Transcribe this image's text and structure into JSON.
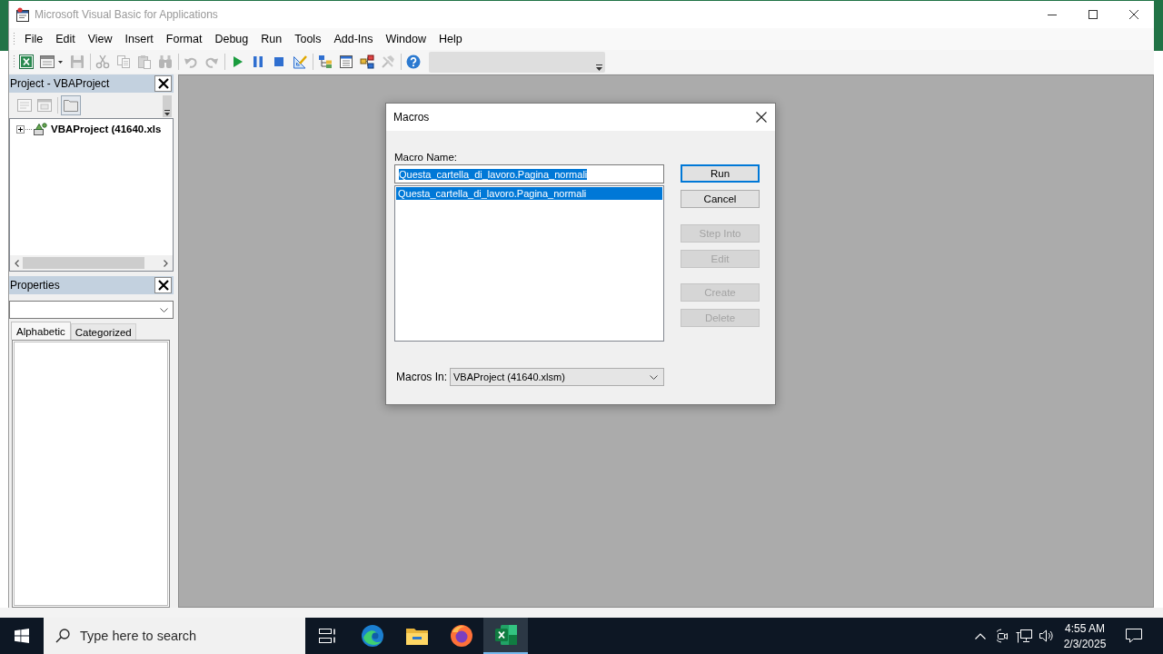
{
  "window": {
    "title": "Microsoft Visual Basic for Applications",
    "active": false
  },
  "menu": [
    "File",
    "Edit",
    "View",
    "Insert",
    "Format",
    "Debug",
    "Run",
    "Tools",
    "Add-Ins",
    "Window",
    "Help"
  ],
  "toolbar": [
    {
      "items": [
        {
          "kind": "view-host",
          "disabled": false
        },
        {
          "kind": "userform",
          "disabled": false
        },
        {
          "kind": "save",
          "disabled": true
        }
      ]
    },
    {
      "items": [
        {
          "kind": "cut",
          "disabled": true
        },
        {
          "kind": "copy",
          "disabled": true
        },
        {
          "kind": "paste",
          "disabled": true
        },
        {
          "kind": "find",
          "disabled": true
        }
      ]
    },
    {
      "items": [
        {
          "kind": "undo",
          "disabled": true
        },
        {
          "kind": "redo",
          "disabled": true
        }
      ]
    },
    {
      "items": [
        {
          "kind": "run",
          "disabled": false
        },
        {
          "kind": "break",
          "disabled": false
        },
        {
          "kind": "reset",
          "disabled": false
        },
        {
          "kind": "design-mode",
          "disabled": false
        }
      ]
    },
    {
      "items": [
        {
          "kind": "project-explorer",
          "disabled": false
        },
        {
          "kind": "properties",
          "disabled": false
        },
        {
          "kind": "object-browser",
          "disabled": false
        },
        {
          "kind": "toolbox",
          "disabled": true
        }
      ]
    },
    {
      "items": [
        {
          "kind": "help",
          "disabled": false
        }
      ]
    }
  ],
  "project_pane": {
    "title": "Project - VBAProject",
    "tools": [
      {
        "kind": "view-code",
        "disabled": true,
        "pressed": false
      },
      {
        "kind": "view-object",
        "disabled": true,
        "pressed": false
      },
      {
        "kind": "toggle-folders",
        "disabled": false,
        "pressed": true
      }
    ],
    "tree": [
      {
        "label": "VBAProject (41640.xls",
        "expanded": false
      }
    ]
  },
  "properties_pane": {
    "title": "Properties",
    "tabs": [
      {
        "label": "Alphabetic",
        "selected": true
      },
      {
        "label": "Categorized",
        "selected": false
      }
    ]
  },
  "dialog": {
    "title": "Macros",
    "macro_name_label": "Macro Name:",
    "macro_name": {
      "value": "Questa_cartella_di_lavoro.Pagina_normali",
      "text_selected": true
    },
    "macros": [
      {
        "label": "Questa_cartella_di_lavoro.Pagina_normali",
        "selected": true
      }
    ],
    "button_groups": [
      [
        {
          "label": "Run",
          "default": true,
          "disabled": false
        },
        {
          "label": "Cancel",
          "default": false,
          "disabled": false
        }
      ],
      [
        {
          "label": "Step Into",
          "default": false,
          "disabled": true
        },
        {
          "label": "Edit",
          "default": false,
          "disabled": true
        }
      ],
      [
        {
          "label": "Create",
          "default": false,
          "disabled": true
        },
        {
          "label": "Delete",
          "default": false,
          "disabled": true
        }
      ]
    ],
    "macros_in": {
      "label": "Macros In:",
      "value": "VBAProject (41640.xlsm)"
    }
  },
  "taskbar": {
    "search": {
      "placeholder": "Type here to search"
    },
    "apps": [
      {
        "kind": "task-view",
        "active": false
      },
      {
        "kind": "edge",
        "active": false
      },
      {
        "kind": "explorer",
        "active": false
      },
      {
        "kind": "firefox",
        "active": false
      },
      {
        "kind": "excel",
        "active": true
      }
    ],
    "clock": {
      "time": "4:55 AM",
      "date": "2/3/2025"
    }
  }
}
